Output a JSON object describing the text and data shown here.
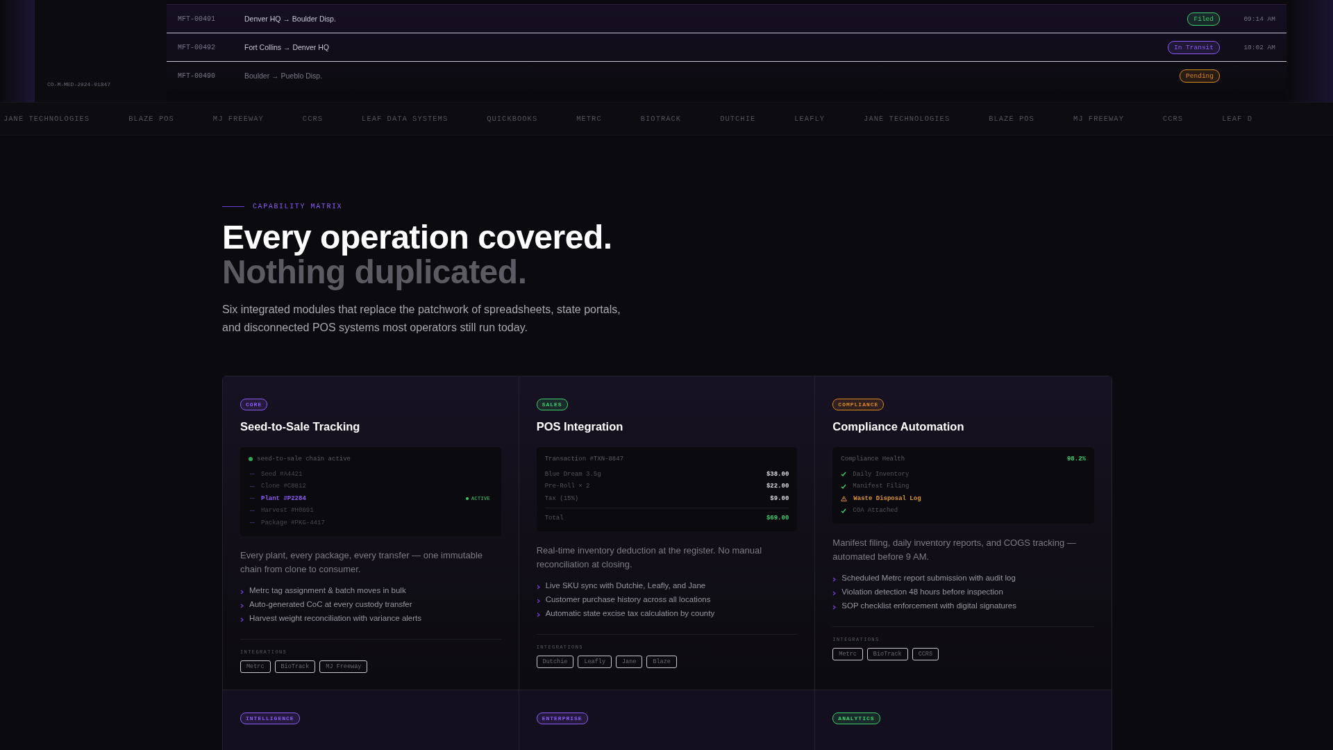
{
  "manifests": [
    {
      "id": "MFT-00491",
      "route": "Denver HQ → Boulder Disp.",
      "status": "Filed",
      "color": "#3ecf6e",
      "time": "09:14 AM"
    },
    {
      "id": "MFT-00492",
      "route": "Fort Collins → Denver HQ",
      "status": "In Transit",
      "color": "#8b5cf6",
      "time": "10:02 AM"
    },
    {
      "id": "MFT-00490",
      "route": "Boulder → Pueblo Disp.",
      "status": "Pending",
      "color": "#d98a1f"
    }
  ],
  "license": "CO-M-MED-2024-01847",
  "ticker": [
    "JANE TECHNOLOGIES",
    "BLAZE POS",
    "MJ FREEWAY",
    "CCRS",
    "LEAF DATA SYSTEMS",
    "QUICKBOOKS",
    "METRC",
    "BIOTRACK",
    "DUTCHIE",
    "LEAFLY",
    "JANE TECHNOLOGIES",
    "BLAZE POS",
    "MJ FREEWAY",
    "CCRS",
    "LEAF D"
  ],
  "section": {
    "eyebrow": "CAPABILITY MATRIX",
    "title": "Every operation covered.",
    "subtitle": "Nothing duplicated.",
    "lead": "Six integrated modules that replace the patchwork of spreadsheets, state portals, and disconnected POS systems most operators still run today."
  },
  "cards": [
    {
      "badge": "CORE",
      "color": "#8b5cf6",
      "title": "Seed-to-Sale Tracking",
      "kind": "chain",
      "panel": {
        "header": "seed-to-sale chain active",
        "steps": [
          {
            "label": "Seed #A4421",
            "selected": false
          },
          {
            "label": "Clone #C8812",
            "selected": false
          },
          {
            "label": "Plant #P2284",
            "selected": true,
            "tag": "ACTIVE"
          },
          {
            "label": "Harvest #H0891",
            "selected": false
          },
          {
            "label": "Package #PKG-4417",
            "selected": false
          }
        ]
      },
      "description": "Every plant, every package, every transfer — one immutable chain from clone to consumer.",
      "bullets": [
        "Metrc tag assignment & batch moves in bulk",
        "Auto-generated CoC at every custody transfer",
        "Harvest weight reconciliation with variance alerts"
      ],
      "integrations_label": "INTEGRATIONS",
      "integrations": [
        "Metrc",
        "BioTrack",
        "MJ Freeway"
      ]
    },
    {
      "badge": "SALES",
      "color": "#3ecf6e",
      "title": "POS Integration",
      "kind": "receipt",
      "panel": {
        "header": "Transaction #TXN-8847",
        "lines": [
          {
            "kind": "item",
            "label": "Blue Dream 3.5g",
            "amount": "$38.00"
          },
          {
            "kind": "item",
            "label": "Pre-Roll × 2",
            "amount": "$22.00"
          },
          {
            "kind": "item",
            "label": "Tax (15%)",
            "amount": "$9.00"
          },
          {
            "kind": "total",
            "label": "Total",
            "amount": "$69.00"
          }
        ]
      },
      "description": "Real-time inventory deduction at the register. No manual reconciliation at closing.",
      "bullets": [
        "Live SKU sync with Dutchie, Leafly, and Jane",
        "Customer purchase history across all locations",
        "Automatic state excise tax calculation by county"
      ],
      "integrations_label": "INTEGRATIONS",
      "integrations": [
        "Dutchie",
        "Leafly",
        "Jane",
        "Blaze"
      ]
    },
    {
      "badge": "COMPLIANCE",
      "color": "#d98a1f",
      "title": "Compliance Automation",
      "kind": "checklist",
      "panel": {
        "header": "Compliance Health",
        "score": "98.2%",
        "checks": [
          {
            "kind": "ok",
            "label": "Daily Inventory"
          },
          {
            "kind": "ok",
            "label": "Manifest Filing"
          },
          {
            "kind": "warn",
            "label": "Waste Disposal Log"
          },
          {
            "kind": "ok",
            "label": "COA Attached"
          }
        ]
      },
      "description": "Manifest filing, daily inventory reports, and COGS tracking — automated before 9 AM.",
      "bullets": [
        "Scheduled Metrc report submission with audit log",
        "Violation detection 48 hours before inspection",
        "SOP checklist enforcement with digital signatures"
      ],
      "integrations_label": "INTEGRATIONS",
      "integrations": [
        "Metrc",
        "BioTrack",
        "CCRS"
      ]
    },
    {
      "badge": "INTELLIGENCE",
      "color": "#8b5cf6",
      "kind": "stub"
    },
    {
      "badge": "ENTERPRISE",
      "color": "#8b5cf6",
      "kind": "stub"
    },
    {
      "badge": "ANALYTICS",
      "color": "#3ecf6e",
      "kind": "stub"
    }
  ]
}
